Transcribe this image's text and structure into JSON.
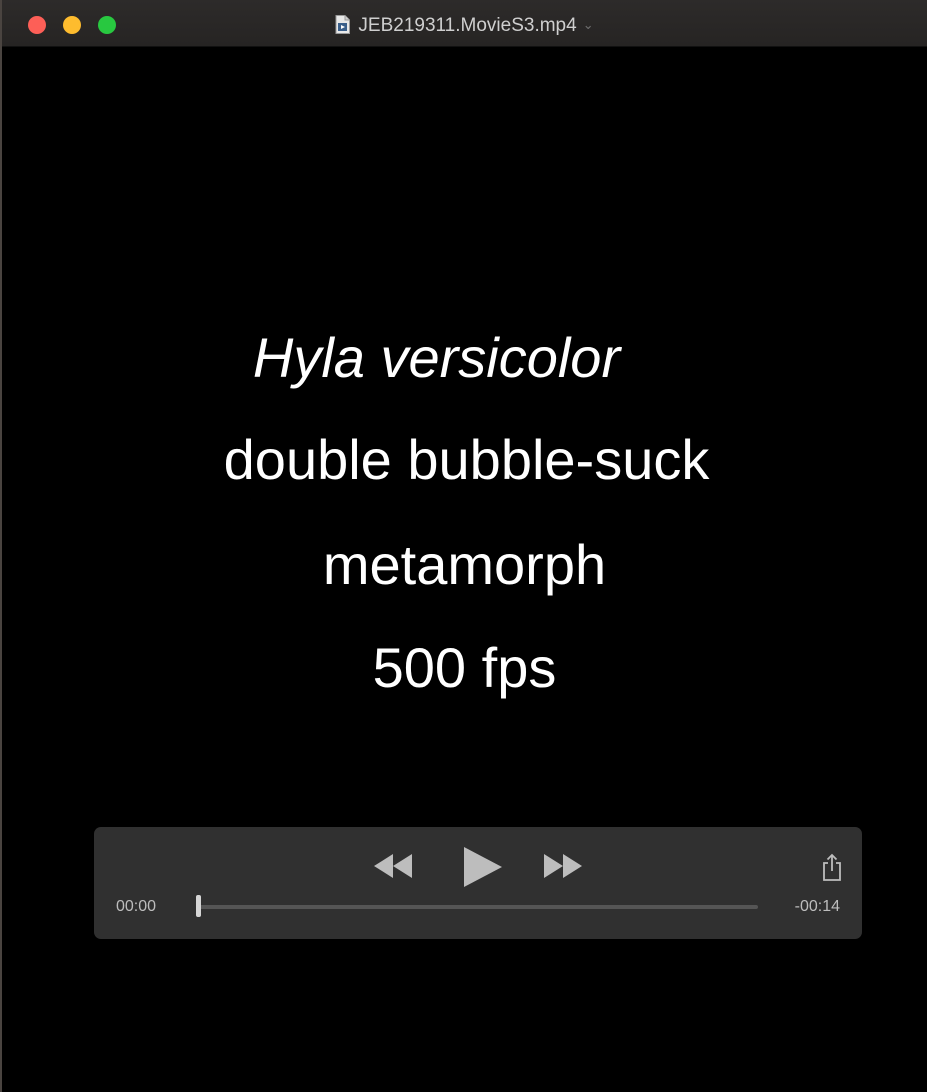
{
  "window": {
    "title": "JEB219311.MovieS3.mp4"
  },
  "video": {
    "caption_lines": [
      "Hyla versicolor",
      "double bubble-suck",
      "metamorph",
      "500 fps"
    ]
  },
  "controls": {
    "current_time": "00:00",
    "remaining_time": "-00:14",
    "progress_fraction": 0.0,
    "icons": {
      "rewind": "rewind-icon",
      "play": "play-icon",
      "fast_forward": "fast-forward-icon",
      "share": "share-icon"
    }
  },
  "colors": {
    "close": "#fd5f57",
    "minimize": "#febc2e",
    "maximize": "#28c840",
    "controls_bg": "#343434",
    "control_icon": "#bdbdbd"
  }
}
